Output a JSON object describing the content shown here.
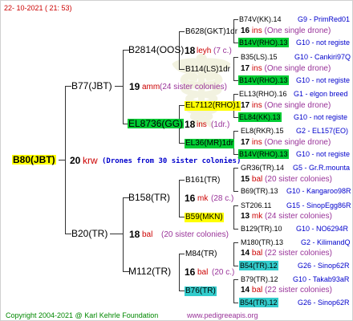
{
  "header_date": "22- 10-2021 ( 21: 53)",
  "footer": {
    "copyright": "Copyright 2004-2021 @ Karl Kehrle Foundation",
    "url": "www.pedigreeapis.org"
  },
  "root": {
    "id": "B80(JBT)",
    "year": "20",
    "year_code": "krw",
    "drone_note": "(Drones from 30 sister colonies)"
  },
  "sire": {
    "id": "B77(JBT)",
    "year": "19",
    "year_code": "amm",
    "note": "(24 sister colonies)",
    "sire": {
      "id": "B2814(OOS)",
      "year": "18",
      "year_code": "leyh",
      "note": "(7 c.)",
      "sire": {
        "id": "B628(GKT)1dr",
        "year": "16",
        "year_code": "ins",
        "note": "(One single drone)",
        "leaves": [
          "B74V(KK).14",
          "G9 - PrimRed01",
          "B14V(RHO).13",
          "G10 - not registe"
        ]
      },
      "dam": {
        "id": "B114(LS)1dr",
        "year": "17",
        "year_code": "ins",
        "note": "(One single drone)",
        "leaves": [
          "B35(LS).15",
          "G10 - Cankiri97Q",
          "B14V(RHO).13",
          "G10 - not registe"
        ]
      }
    },
    "dam": {
      "id": "EL8736(GG)",
      "year": "18",
      "year_code": "ins",
      "note": "(1dr.)",
      "sire": {
        "id": "EL7112(RHO)1",
        "year": "17",
        "year_code": "ins",
        "note": "(One single drone)",
        "leaves": [
          "EL13(RHO).16",
          "G1 - elgon breed",
          "EL84(KK).13",
          "G10 - not registe"
        ]
      },
      "dam": {
        "id": "EL36(MR)1dr",
        "year": "17",
        "year_code": "ins",
        "note": "(One single drone)",
        "leaves": [
          "EL8(RKR).15",
          "G2 - EL157(EO)",
          "B14V(RHO).13",
          "G10 - not registe"
        ]
      }
    }
  },
  "dam": {
    "id": "B20(TR)",
    "year": "18",
    "year_code": "bal",
    "note": "(20 sister colonies)",
    "sire": {
      "id": "B158(TR)",
      "year": "16",
      "year_code": "mk",
      "note": "(28 c.)",
      "sire": {
        "id": "B161(TR)",
        "year": "15",
        "year_code": "bal",
        "note": "(20 sister colonies)",
        "leaves": [
          "GR36(TR).14",
          "G5 - Gr.R.mounta",
          "B69(TR).13",
          "G10 - Kangaroo98R"
        ]
      },
      "dam": {
        "id": "B59(MKN)",
        "year": "13",
        "year_code": "mk",
        "note": "(24 sister colonies)",
        "leaves": [
          "ST206.11",
          "G15 - SinopEgg86R",
          "B129(TR).10",
          "G10 - NO6294R"
        ]
      }
    },
    "dam": {
      "id": "M112(TR)",
      "year": "16",
      "year_code": "bal",
      "note": "(20 c.)",
      "sire": {
        "id": "M84(TR)",
        "year": "14",
        "year_code": "bal",
        "note": "(22 sister colonies)",
        "leaves": [
          "M180(TR).13",
          "G2 - KilimandQ",
          "B54(TR).12",
          "G26 - Sinop62R"
        ]
      },
      "dam": {
        "id": "B76(TR)",
        "year": "14",
        "year_code": "bal",
        "note": "(22 sister colonies)",
        "leaves": [
          "B79(TR).12",
          "G10 - Takab93aR",
          "B54(TR).12",
          "G26 - Sinop62R"
        ]
      }
    }
  }
}
